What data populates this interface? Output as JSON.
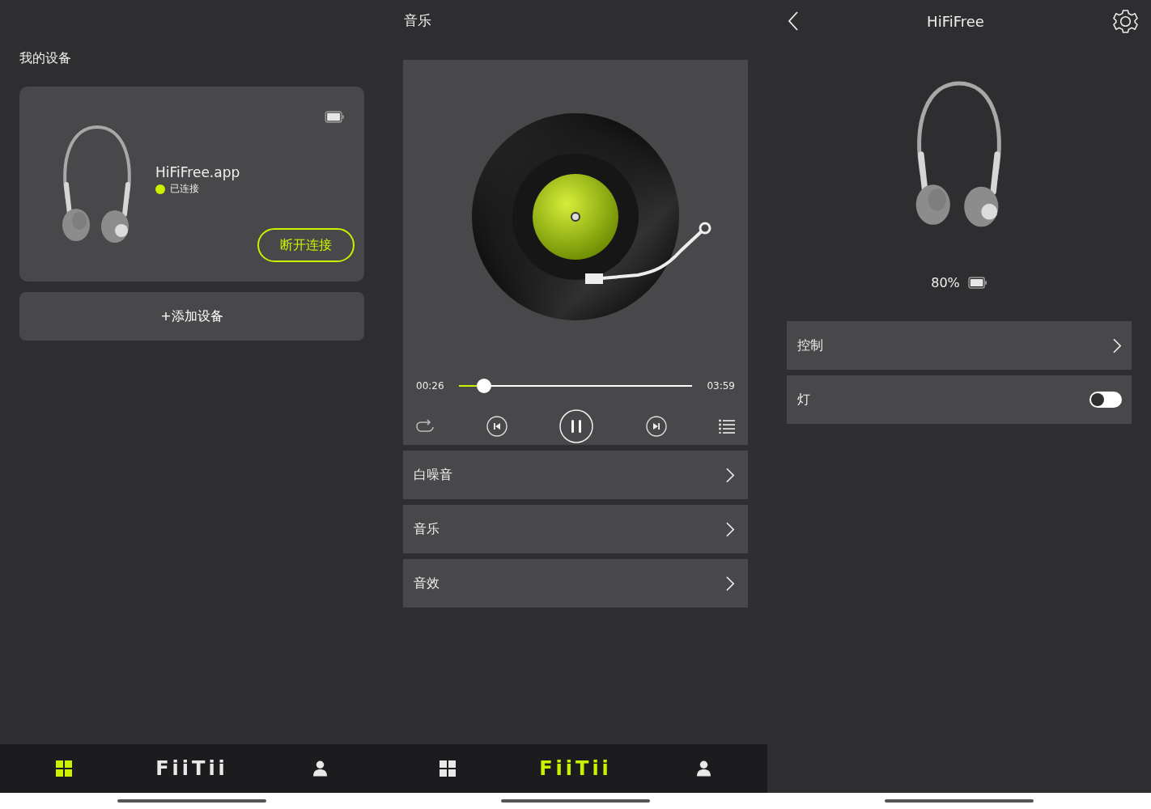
{
  "devices_screen": {
    "heading": "我的设备",
    "device_card": {
      "name": "HiFiFree.app",
      "connected": true,
      "status": "已连接",
      "button": "断开连接"
    },
    "add_button": "+添加设备",
    "nav": [
      {
        "kind": "grid",
        "selected": true
      },
      {
        "kind": "logo",
        "label": "FiiTii",
        "selected": false
      },
      {
        "kind": "person",
        "selected": false
      }
    ]
  },
  "music_screen": {
    "title": "音乐",
    "player": {
      "elapsed": "00:26",
      "duration": "03:59",
      "level": 0.11,
      "playing": true
    },
    "menu": [
      "白噪音",
      "音乐",
      "音效"
    ],
    "nav": [
      {
        "kind": "grid",
        "selected": false
      },
      {
        "kind": "logo",
        "label": "FiiTii",
        "selected": true
      },
      {
        "kind": "person",
        "selected": false
      }
    ]
  },
  "detail_screen": {
    "title": "HiFiFree",
    "battery": "80%",
    "settings": [
      {
        "kind": "link",
        "label": "控制"
      },
      {
        "kind": "toggle",
        "label": "灯",
        "on": false
      }
    ]
  }
}
